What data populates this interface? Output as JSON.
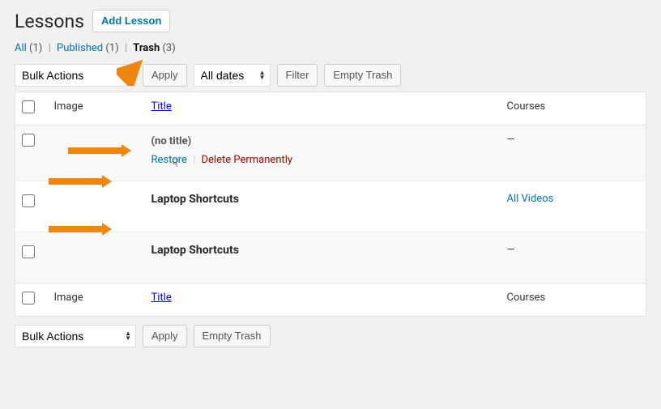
{
  "header": {
    "title": "Lessons",
    "add_button": "Add Lesson"
  },
  "filters": {
    "all_label": "All",
    "all_count": "(1)",
    "published_label": "Published",
    "published_count": "(1)",
    "trash_label": "Trash",
    "trash_count": "(3)"
  },
  "bulk": {
    "label": "Bulk Actions",
    "apply": "Apply"
  },
  "dates": {
    "all": "All dates"
  },
  "buttons": {
    "filter": "Filter",
    "empty_trash": "Empty Trash"
  },
  "columns": {
    "image": "Image",
    "title": "Title",
    "courses": "Courses"
  },
  "rows": [
    {
      "title": "(no title)",
      "courses": "—",
      "actions": {
        "restore": "Restore",
        "delete": "Delete Permanently"
      }
    },
    {
      "title": "Laptop Shortcuts",
      "courses": "All Videos",
      "courses_is_link": true
    },
    {
      "title": "Laptop Shortcuts",
      "courses": "—"
    }
  ]
}
